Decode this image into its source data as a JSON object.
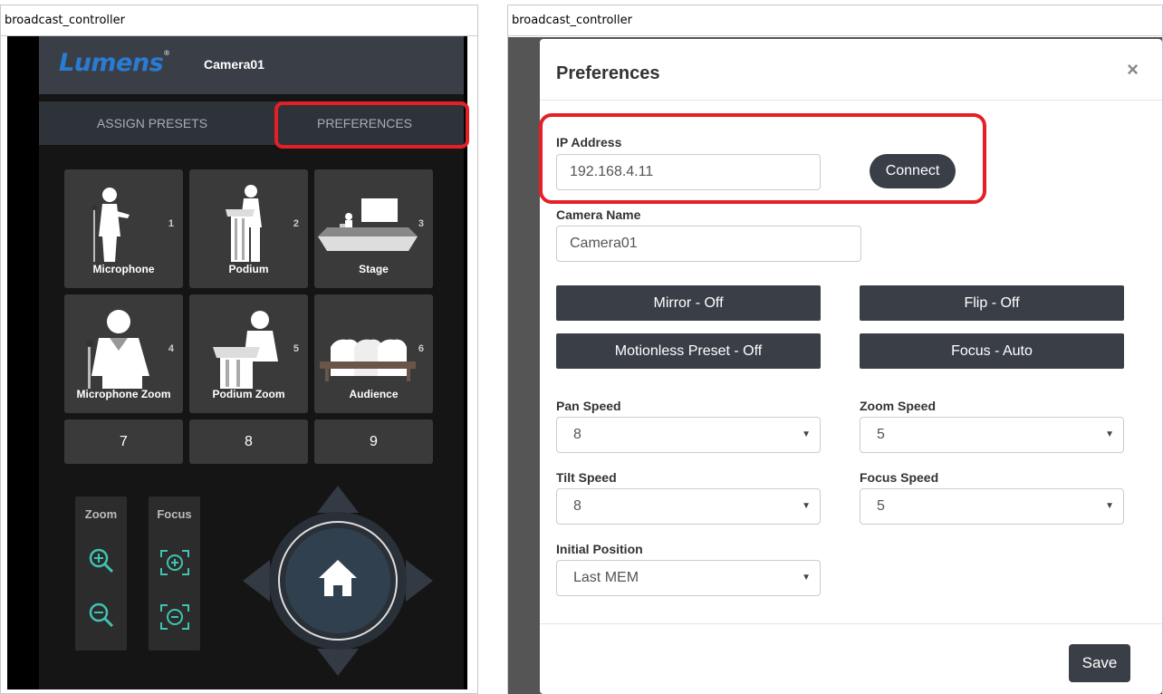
{
  "left_window": {
    "title": "broadcast_controller",
    "brand": "Lumens",
    "camera_name": "Camera01",
    "tabs": [
      "ASSIGN PRESETS",
      "PREFERENCES"
    ],
    "presets": [
      {
        "num": "1",
        "label": "Microphone"
      },
      {
        "num": "2",
        "label": "Podium"
      },
      {
        "num": "3",
        "label": "Stage"
      },
      {
        "num": "4",
        "label": "Microphone Zoom"
      },
      {
        "num": "5",
        "label": "Podium Zoom"
      },
      {
        "num": "6",
        "label": "Audience"
      }
    ],
    "number_buttons": [
      "7",
      "8",
      "9"
    ],
    "zoom_label": "Zoom",
    "focus_label": "Focus",
    "highlight_color": "#e41f26"
  },
  "right_window": {
    "title": "broadcast_controller",
    "modal_title": "Preferences",
    "close": "×",
    "ip_label": "IP Address",
    "ip_value": "192.168.4.11",
    "connect_label": "Connect",
    "camera_name_label": "Camera Name",
    "camera_name_value": "Camera01",
    "toggles": [
      "Mirror - Off",
      "Flip - Off",
      "Motionless Preset - Off",
      "Focus - Auto"
    ],
    "pan_speed_label": "Pan Speed",
    "pan_speed": "8",
    "zoom_speed_label": "Zoom Speed",
    "zoom_speed": "5",
    "tilt_speed_label": "Tilt Speed",
    "tilt_speed": "8",
    "focus_speed_label": "Focus Speed",
    "focus_speed": "5",
    "initial_position_label": "Initial Position",
    "initial_position": "Last MEM",
    "save_label": "Save"
  }
}
